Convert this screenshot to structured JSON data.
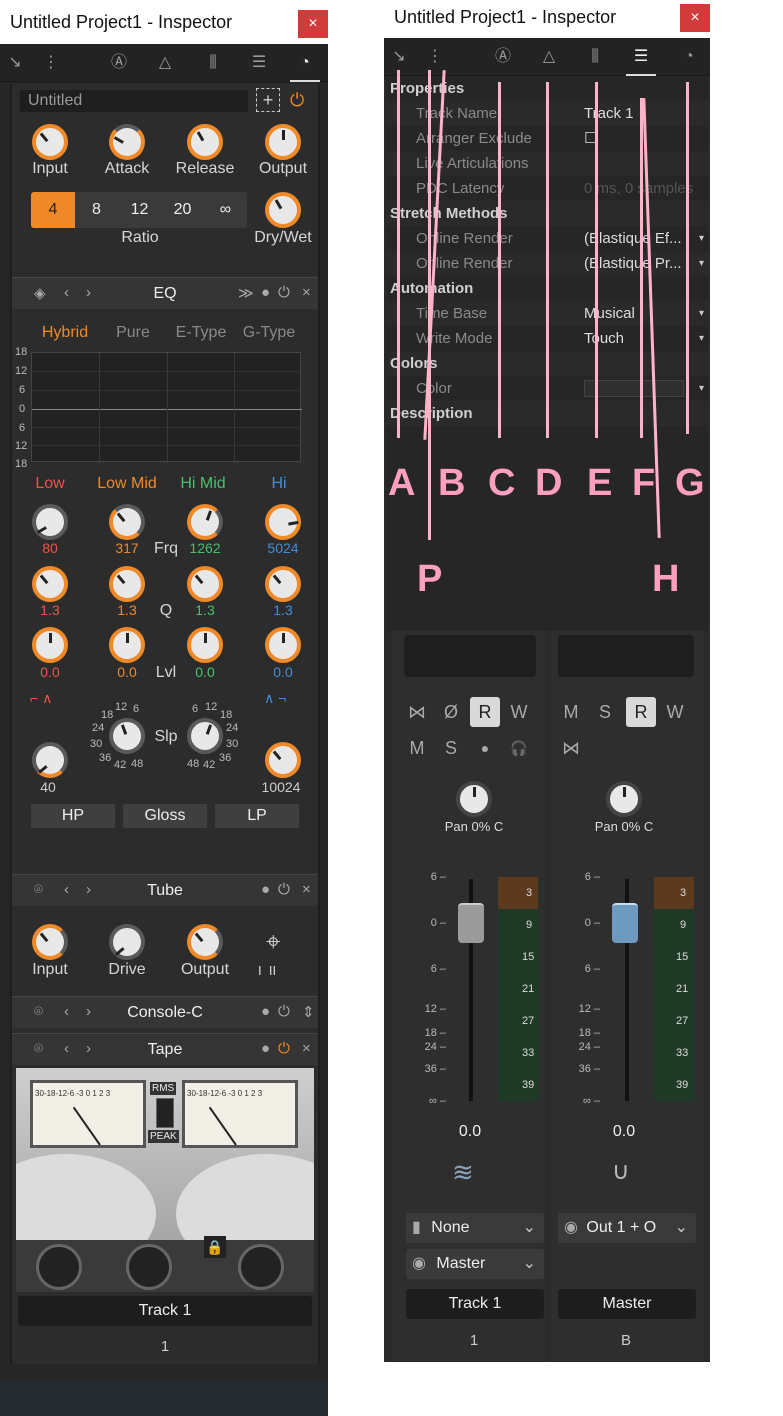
{
  "left_window": {
    "title": "Untitled Project1 - Inspector",
    "close": "×",
    "preset_name": "Untitled",
    "compressor": {
      "knobs": [
        "Input",
        "Attack",
        "Release",
        "Output"
      ],
      "ratio_options": [
        "4",
        "8",
        "12",
        "20",
        "∞"
      ],
      "ratio_selected": "4",
      "ratio_label": "Ratio",
      "drywet_label": "Dry/Wet"
    },
    "eq": {
      "name": "EQ",
      "modes": [
        "Hybrid",
        "Pure",
        "E-Type",
        "G-Type"
      ],
      "active_mode": "Hybrid",
      "graph_scale": [
        "18",
        "12",
        "6",
        "0",
        "6",
        "12",
        "18"
      ],
      "bands": [
        "Low",
        "Low Mid",
        "Hi Mid",
        "Hi"
      ],
      "band_colors": [
        "#e8564a",
        "#f08a28",
        "#4cbf6a",
        "#3f8fe0"
      ],
      "frq": [
        "80",
        "317",
        "1262",
        "5024"
      ],
      "q": [
        "1.3",
        "1.3",
        "1.3",
        "1.3"
      ],
      "lvl": [
        "0.0",
        "0.0",
        "0.0",
        "0.0"
      ],
      "row_labels": {
        "frq": "Frq",
        "q": "Q",
        "lvl": "Lvl",
        "slp": "Slp"
      },
      "slope_left_scale": [
        "12",
        "6",
        "18",
        "24",
        "30",
        "36",
        "42",
        "48"
      ],
      "slope_right_scale": [
        "6",
        "12",
        "18",
        "24",
        "30",
        "36",
        "42",
        "48"
      ],
      "hp_value": "40",
      "lp_value": "10024",
      "filter_buttons": [
        "HP",
        "Gloss",
        "LP"
      ]
    },
    "tube": {
      "name": "Tube",
      "knobs": [
        "Input",
        "Drive",
        "Output"
      ],
      "switch": "I  II"
    },
    "console": {
      "name": "Console-C"
    },
    "tape": {
      "name": "Tape",
      "meter_toggle_top": "RMS",
      "meter_toggle_bottom": "PEAK",
      "meter_scale": "30-18-12-6 -3 0 1 2 3"
    },
    "track_name": "Track 1",
    "track_number": "1"
  },
  "right_window": {
    "title": "Untitled Project1 - Inspector",
    "close": "×",
    "properties": [
      {
        "type": "header",
        "label": "Properties"
      },
      {
        "type": "row",
        "key": "Track Name",
        "value": "Track 1"
      },
      {
        "type": "row",
        "key": "Arranger Exclude",
        "value": "☐"
      },
      {
        "type": "row",
        "key": "Live Articulations",
        "value": ""
      },
      {
        "type": "row",
        "key": "PDC Latency",
        "value": "0 ms, 0 samples",
        "dim": true
      },
      {
        "type": "header",
        "label": "Stretch Methods"
      },
      {
        "type": "row",
        "key": "Online Render",
        "value": "(Elastique Ef...",
        "dropdown": true
      },
      {
        "type": "row",
        "key": "Offline Render",
        "value": "(Elastique Pr...",
        "dropdown": true
      },
      {
        "type": "header",
        "label": "Automation"
      },
      {
        "type": "row",
        "key": "Time Base",
        "value": "Musical",
        "dropdown": true
      },
      {
        "type": "row",
        "key": "Write Mode",
        "value": "Touch",
        "dropdown": true
      },
      {
        "type": "header",
        "label": "Colors"
      },
      {
        "type": "row",
        "key": "Color",
        "value": "",
        "dropdown": true
      },
      {
        "type": "header",
        "label": "Description"
      }
    ],
    "annotations": [
      "A",
      "B",
      "C",
      "D",
      "E",
      "F",
      "G",
      "P",
      "H"
    ],
    "strips": [
      {
        "buttons_row1": [
          "⋈",
          "Ø",
          "R",
          "W"
        ],
        "buttons_row2": [
          "M",
          "S",
          "●",
          "🎧"
        ],
        "pan": "Pan 0% C",
        "fader_value": "0.0",
        "input": "None",
        "output": "Master",
        "name": "Track 1",
        "number": "1",
        "fader_color": "#9b9b9b"
      },
      {
        "buttons_row1": [
          "M",
          "S",
          "R",
          "W"
        ],
        "buttons_row2": [
          "⋈"
        ],
        "pan": "Pan 0% C",
        "fader_value": "0.0",
        "output": "Out 1 + O",
        "name": "Master",
        "number": "B",
        "fader_color": "#6f9ac0"
      }
    ],
    "fader_scale": [
      "6",
      "0",
      "6",
      "12",
      "18",
      "24",
      "36",
      "∞"
    ],
    "meter_scale": [
      "3",
      "9",
      "15",
      "21",
      "27",
      "33",
      "39"
    ]
  }
}
